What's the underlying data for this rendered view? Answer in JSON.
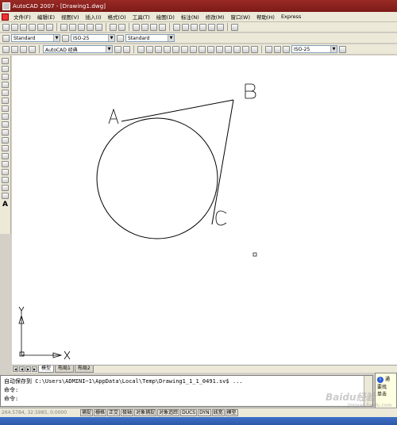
{
  "window": {
    "title": "AutoCAD 2007 - [Drawing1.dwg]"
  },
  "menu": [
    "文件(F)",
    "编辑(E)",
    "视图(V)",
    "插入(I)",
    "格式(O)",
    "工具(T)",
    "绘图(D)",
    "标注(N)",
    "修改(M)",
    "窗口(W)",
    "帮助(H)",
    "Express"
  ],
  "toolbars": {
    "text_style": "Standard",
    "dim_style": "ISO-25",
    "table_style": "Standard",
    "workspace": "AutoCAD 经典",
    "dim_style2": "ISO-25"
  },
  "drawing": {
    "label_a": "A",
    "label_b": "B",
    "label_c": "C",
    "ucs_x": "X",
    "ucs_y": "Y"
  },
  "tabs": {
    "model": "模型",
    "layout1": "布局1",
    "layout2": "布局2"
  },
  "command": {
    "line1": "自动保存到 C:\\Users\\ADMINI~1\\AppData\\Local\\Temp\\Drawing1_1_1_0491.sv$ ...",
    "line2": "命令:",
    "line3": "命令:"
  },
  "balloon": {
    "text1": "通",
    "text2": "要找",
    "text3": "单击"
  },
  "status": {
    "coords": "264.5784, 32.5985, 0.0000",
    "buttons": [
      "捕捉",
      "栅格",
      "正交",
      "极轴",
      "对象捕捉",
      "对象追踪",
      "DUCS",
      "DYN",
      "线宽",
      "模型"
    ]
  },
  "watermark": {
    "logo": "Baidu经验",
    "url": "jingyan.baidu.com"
  },
  "colors": {
    "titlebar": "#8b2220",
    "canvas": "#ffffff",
    "linework": "#000000"
  }
}
